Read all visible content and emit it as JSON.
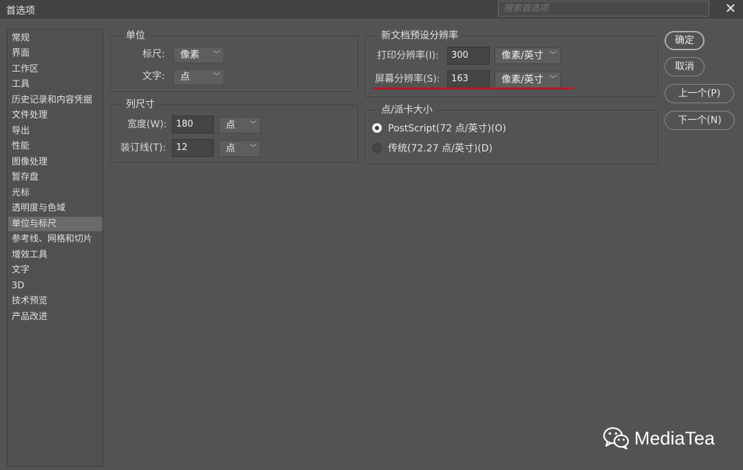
{
  "window": {
    "title": "首选项",
    "search_placeholder": "搜索首选项",
    "close_glyph": "✕"
  },
  "sidebar": {
    "items": [
      {
        "label": "常规"
      },
      {
        "label": "界面"
      },
      {
        "label": "工作区"
      },
      {
        "label": "工具"
      },
      {
        "label": "历史记录和内容凭据"
      },
      {
        "label": "文件处理"
      },
      {
        "label": "导出"
      },
      {
        "label": "性能"
      },
      {
        "label": "图像处理"
      },
      {
        "label": "暂存盘"
      },
      {
        "label": "光标"
      },
      {
        "label": "透明度与色域"
      },
      {
        "label": "单位与标尺"
      },
      {
        "label": "参考线、网格和切片"
      },
      {
        "label": "增效工具"
      },
      {
        "label": "文字"
      },
      {
        "label": "3D"
      },
      {
        "label": "技术预览"
      },
      {
        "label": "产品改进"
      }
    ],
    "selected": "单位与标尺"
  },
  "units": {
    "title": "单位",
    "ruler_label": "标尺:",
    "ruler_value": "像素",
    "type_label": "文字:",
    "type_value": "点"
  },
  "column_size": {
    "title": "列尺寸",
    "width_label": "宽度(W):",
    "width_value": "180",
    "width_unit": "点",
    "gutter_label": "装订线(T):",
    "gutter_value": "12",
    "gutter_unit": "点"
  },
  "new_doc_res": {
    "title": "新文档预设分辨率",
    "print_label": "打印分辨率(I):",
    "print_value": "300",
    "print_unit": "像素/英寸",
    "screen_label": "屏幕分辨率(S):",
    "screen_value": "163",
    "screen_unit": "像素/英寸"
  },
  "point_size": {
    "title": "点/派卡大小",
    "options": [
      {
        "label": "PostScript(72 点/英寸)(O)",
        "selected": true
      },
      {
        "label": "传统(72.27 点/英寸)(D)",
        "selected": false
      }
    ]
  },
  "buttons": {
    "ok": "确定",
    "cancel": "取消",
    "prev": "上一个(P)",
    "next": "下一个(N)"
  },
  "watermark": {
    "text": "MediaTea"
  },
  "colors": {
    "background": "#535353",
    "highlight_line": "#b8192a",
    "selected_item": "#6a6a6a"
  }
}
